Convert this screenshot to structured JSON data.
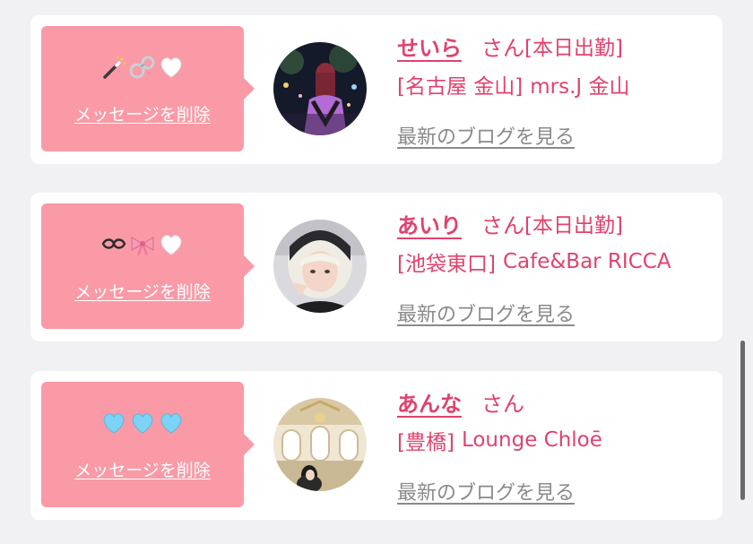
{
  "delete_label": "メッセージを削除",
  "blog_label": "最新のブログを見る",
  "san_label": "さん",
  "cards": [
    {
      "name": "せいら",
      "status": "[本日出勤]",
      "shop_area": "[名古屋 金山]",
      "shop_name": "mrs.J 金山",
      "emojis": [
        "magic-wand-icon",
        "handcuffs-icon",
        "white-heart-icon"
      ]
    },
    {
      "name": "あいり",
      "status": "[本日出勤]",
      "shop_area": "[池袋東口]",
      "shop_name": "Cafe&Bar RICCA",
      "emojis": [
        "loop-icon",
        "ribbon-icon",
        "white-heart-icon"
      ]
    },
    {
      "name": "あんな",
      "status": "",
      "shop_area": "[豊橋]",
      "shop_name": "Lounge Chloē",
      "emojis": [
        "light-blue-heart-icon",
        "light-blue-heart-icon",
        "light-blue-heart-icon"
      ]
    }
  ],
  "colors": {
    "accent": "#e0426d",
    "bubble": "#f99aa6",
    "link_gray": "#8a8a8a",
    "background": "#f1f1f3"
  }
}
